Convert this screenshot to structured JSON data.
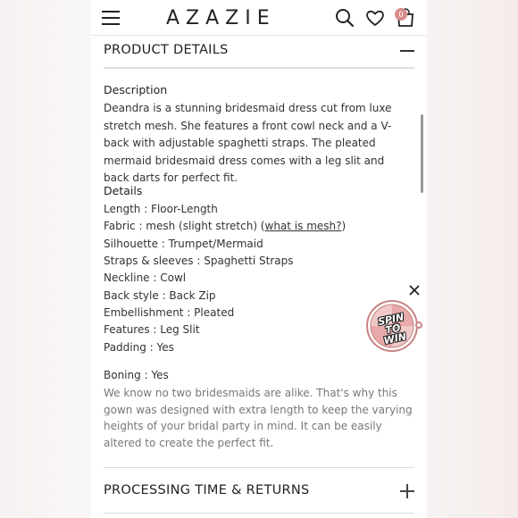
{
  "header": {
    "brand": "AZAZIE",
    "cart_count": "0"
  },
  "icons": {
    "menu": "hamburger-menu-icon",
    "search": "search-icon",
    "wishlist": "heart-icon",
    "cart": "shopping-bag-icon"
  },
  "product_details": {
    "title": "PRODUCT DETAILS",
    "description_label": "Description",
    "description_text": "Deandra is a stunning bridesmaid dress cut from luxe stretch mesh. She features a front cowl neck and a V-back with adjustable spaghetti straps. The pleated mermaid bridesmaid dress comes with a leg slit and back darts for perfect fit.",
    "details_label": "Details",
    "details": [
      "Length : Floor-Length",
      "Fabric : mesh (slight stretch) (",
      "Silhouette : Trumpet/Mermaid",
      "Straps & sleeves : Spaghetti Straps",
      "Neckline : Cowl",
      "Back style : Back Zip",
      "Embellishment : Pleated",
      "Features : Leg Slit",
      "Padding : Yes"
    ],
    "mesh_link": "what is mesh?",
    "mesh_close": ")",
    "boning": "Boning : Yes",
    "note": "We know no two bridesmaids are alike. That's why this gown was designed with extra length to keep the varying heights of your bridal party in mind. It can be easily altered to create the perfect fit."
  },
  "processing": {
    "title": "PROCESSING TIME & RETURNS"
  },
  "promo": {
    "line1": "SPIN",
    "line2": "TO WIN"
  },
  "colors": {
    "accent": "#d98c8c",
    "text": "#333333",
    "muted": "#777777"
  }
}
